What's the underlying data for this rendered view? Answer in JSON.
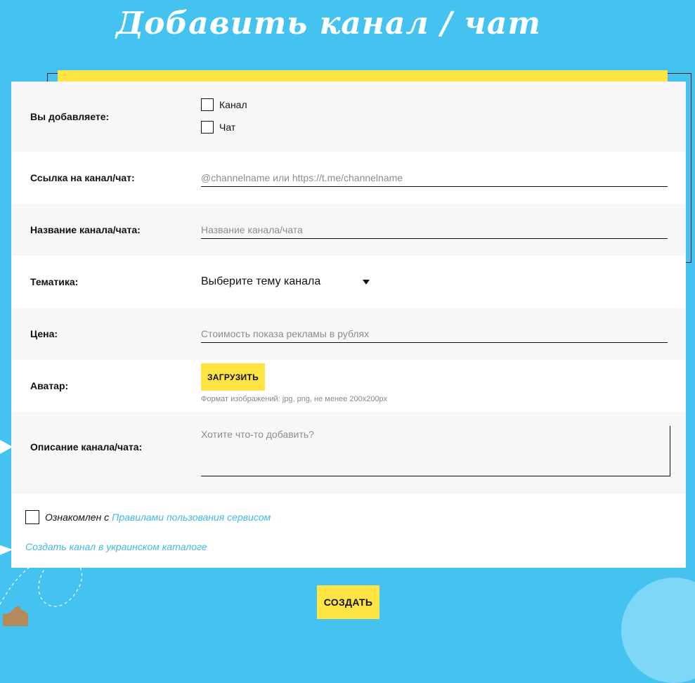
{
  "header": {
    "title": "Добавить канал / чат"
  },
  "form": {
    "type": {
      "label": "Вы добавляете:",
      "options": [
        {
          "label": "Канал",
          "checked": false
        },
        {
          "label": "Чат",
          "checked": false
        }
      ]
    },
    "link": {
      "label": "Ссылка на канал/чат:",
      "placeholder": "@channelname или https://t.me/channelname"
    },
    "name": {
      "label": "Название канала/чата:",
      "placeholder": "Название канала/чата"
    },
    "topic": {
      "label": "Тематика:",
      "selected": "Выберите тему канала"
    },
    "price": {
      "label": "Цена:",
      "placeholder": "Стоимость показа рекламы в рублях"
    },
    "avatar": {
      "label": "Аватар:",
      "button": "ЗАГРУЗИТЬ",
      "hint": "Формат изображений: jpg, png, не менее 200x200px"
    },
    "description": {
      "label": "Описание канала/чата:",
      "placeholder": "Хотите что-то добавить?"
    },
    "agree": {
      "text": "Ознакомлен с",
      "link": "Правилами пользования сервисом",
      "checked": false
    },
    "ukraine_link": "Создать канал в украинском каталоге",
    "submit": "СОЗДАТЬ"
  },
  "colors": {
    "background": "#44c3f1",
    "accent": "#ffe443",
    "link": "#44b7e6"
  }
}
